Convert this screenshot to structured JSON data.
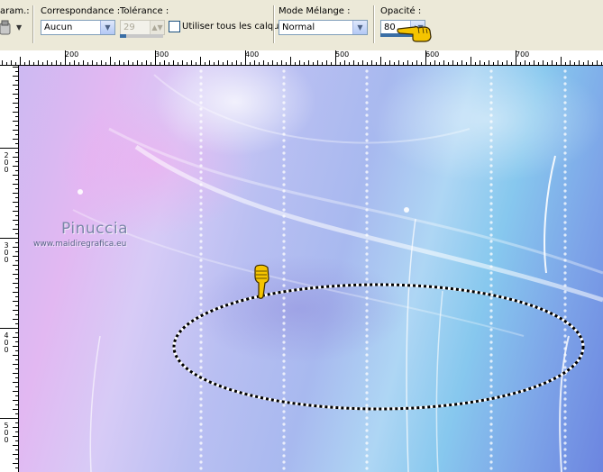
{
  "toolbar": {
    "param_label": "aram.:",
    "match_mode": {
      "label": "Correspondance :",
      "value": "Aucun"
    },
    "tolerance": {
      "label": "Tolérance :",
      "value": "29",
      "level_percent": 15
    },
    "use_all_layers": {
      "label": "Utiliser tous les calques",
      "checked": false
    },
    "blend_mode": {
      "label": "Mode Mélange :",
      "value": "Normal"
    },
    "opacity": {
      "label": "Opacité :",
      "value": "80",
      "level_percent": 80
    }
  },
  "ruler": {
    "horizontal_labels": [
      "200",
      "300",
      "400",
      "500",
      "600",
      "700"
    ],
    "vertical_labels": [
      "200",
      "300",
      "400",
      "500"
    ]
  },
  "canvas": {
    "watermark_title": "Pinuccia",
    "watermark_url": "www.maidiregrafica.eu"
  },
  "icons": {
    "brush": "brush-icon",
    "pointer_hand": "pointing-hand-icon",
    "pointer_hand_down": "pointing-down-hand-icon"
  },
  "colors": {
    "selection_marquee": "#000000",
    "slider_fill": "#3a6ea5",
    "hand_yellow": "#f5c400"
  }
}
